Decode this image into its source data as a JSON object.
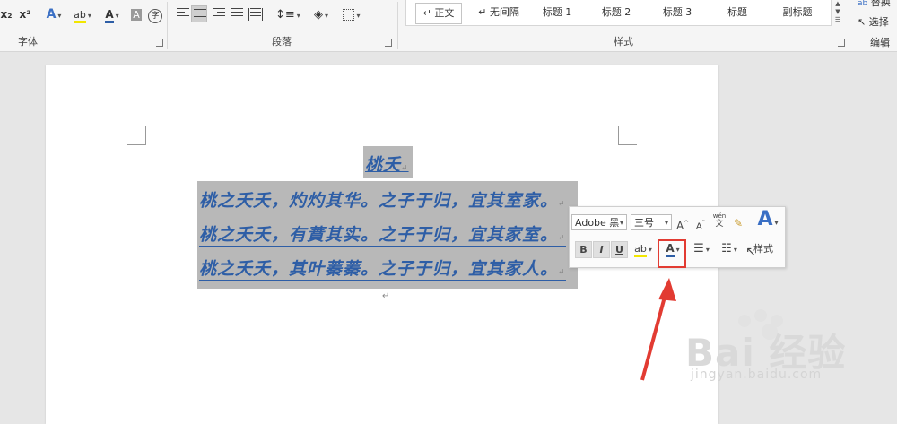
{
  "ribbon": {
    "font_group": {
      "label": "字体",
      "subscript": "x₂",
      "superscript": "x²",
      "text_effects": "A",
      "highlight": "ab",
      "font_color": "A",
      "char_shading": "A",
      "enclosed": "字"
    },
    "paragraph_group": {
      "label": "段落"
    },
    "styles_group": {
      "label": "样式",
      "items": [
        "↵ 正文",
        "↵ 无间隔",
        "标题 1",
        "标题 2",
        "标题 3",
        "标题",
        "副标题"
      ]
    },
    "edit_group": {
      "label": "编辑",
      "replace": "替换",
      "select": "选择"
    }
  },
  "document": {
    "title": "桃夭",
    "lines": [
      "桃之夭夭，灼灼其华。之子于归，宜其室家。",
      "桃之夭夭，有蕡其实。之子于归，宜其家室。",
      "桃之夭夭，其叶蓁蓁。之子于归，宜其家人。"
    ],
    "paragraph_mark": "↵",
    "text_color": "#2e5ea6",
    "selection_color": "#b8b8b8"
  },
  "mini_toolbar": {
    "font_name": "Adobe 黑",
    "font_size": "三号",
    "grow_font": "A",
    "shrink_font": "A",
    "phonetic": "wén",
    "bold": "B",
    "italic": "I",
    "underline": "U",
    "styles_label": "样式",
    "highlight_color": "#e23b32"
  },
  "watermark": {
    "brand": "Bai 经验",
    "url": "jingyan.baidu.com"
  }
}
